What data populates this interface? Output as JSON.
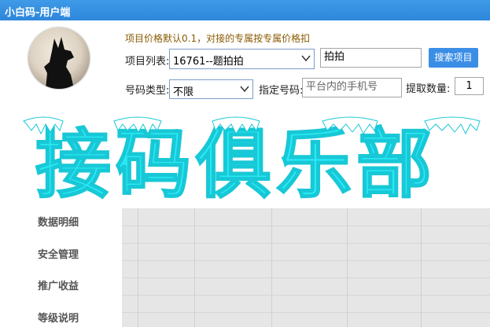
{
  "window": {
    "title": "小白码-用户端"
  },
  "notice": "项目价格默认0.1，对接的专属按专属价格扣",
  "form": {
    "project_list_label": "项目列表:",
    "project_selected": "16761--题拍拍",
    "search_value": "拍拍",
    "search_button": "搜索项目",
    "number_type_label": "号码类型:",
    "number_type_selected": "不限",
    "specified_number_label": "指定号码:",
    "specified_number_placeholder": "平台内的手机号",
    "extract_count_label": "提取数量:",
    "extract_count_value": "1"
  },
  "banner": {
    "text": "接码俱乐部",
    "color": "#29e9f4"
  },
  "sidebar": {
    "items": [
      {
        "label": "数据明细"
      },
      {
        "label": "安全管理"
      },
      {
        "label": "推广收益"
      },
      {
        "label": "等级说明"
      }
    ]
  },
  "colors": {
    "titlebar": "#2d86db",
    "accent_button": "#3a8ee6",
    "notice": "#8a5a00"
  }
}
